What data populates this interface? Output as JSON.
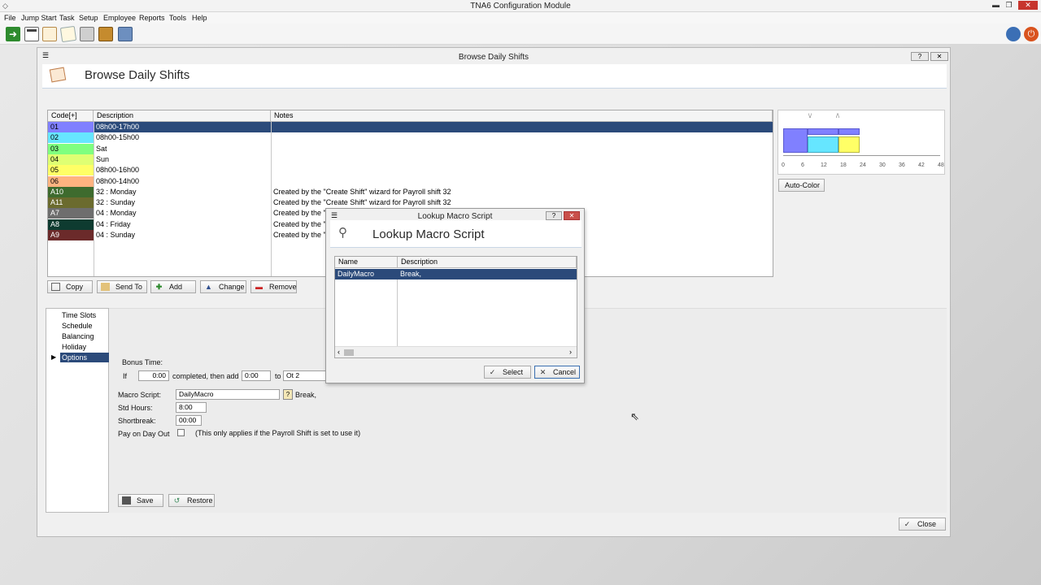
{
  "app": {
    "title": "TNA6 Configuration Module",
    "menu": [
      "File",
      "Jump Start",
      "Task",
      "Setup",
      "Employee",
      "Reports",
      "Tools",
      "Help"
    ],
    "toolbar_icons": [
      "exit-icon",
      "calendar-icon",
      "schedule-icon",
      "notepad-icon",
      "printer-icon",
      "tools-icon",
      "wizard-icon"
    ]
  },
  "window": {
    "title": "Browse Daily Shifts",
    "heading": "Browse Daily Shifts",
    "help_label": "?",
    "close_label": "✕"
  },
  "grid": {
    "columns": [
      "Code[+]",
      "Description",
      "Notes"
    ],
    "rows": [
      {
        "code": "01",
        "color": "#8080ff",
        "description": "08h00-17h00",
        "notes": "",
        "selected": true
      },
      {
        "code": "02",
        "color": "#66e6ff",
        "description": "08h00-15h00",
        "notes": ""
      },
      {
        "code": "03",
        "color": "#7fff7f",
        "description": "Sat",
        "notes": ""
      },
      {
        "code": "04",
        "color": "#dfff73",
        "description": "Sun",
        "notes": ""
      },
      {
        "code": "05",
        "color": "#ffff66",
        "description": "08h00-16h00",
        "notes": ""
      },
      {
        "code": "06",
        "color": "#ffb380",
        "description": "08h00-14h00",
        "notes": ""
      },
      {
        "code": "A10",
        "color": "#3e6b2e",
        "description": "32 : Monday",
        "notes": "Created by the \"Create Shift\" wizard for Payroll shift 32",
        "dark": true
      },
      {
        "code": "A11",
        "color": "#6b6b2e",
        "description": "32 : Sunday",
        "notes": "Created by the \"Create Shift\" wizard for Payroll shift 32",
        "dark": true
      },
      {
        "code": "A7",
        "color": "#6e6e6e",
        "description": "04 : Monday",
        "notes": "Created by the \"C",
        "dark": true
      },
      {
        "code": "A8",
        "color": "#0e3b30",
        "description": "04 : Friday",
        "notes": "Created by the \"C",
        "dark": true
      },
      {
        "code": "A9",
        "color": "#6b2a2a",
        "description": "04 : Sunday",
        "notes": "Created by the \"C",
        "dark": true
      }
    ]
  },
  "grid_buttons": {
    "copy": "Copy",
    "send_to": "Send To",
    "add": "Add",
    "change": "Change",
    "remove": "Remove"
  },
  "preview": {
    "ticks": [
      "0",
      "6",
      "12",
      "18",
      "24",
      "30",
      "36",
      "42",
      "48"
    ],
    "auto_color_label": "Auto-Color"
  },
  "nav": {
    "items": [
      "Time Slots",
      "Schedule",
      "Balancing",
      "Holiday",
      "Options"
    ],
    "selected": "Options"
  },
  "options": {
    "bonus_time_label": "Bonus Time:",
    "if_label": "If",
    "if_value": "0:00",
    "completed_label": "completed, then add",
    "add_value": "0:00",
    "to_label": "to",
    "to_value": "Ot 2",
    "macro_label": "Macro Script:",
    "macro_value": "DailyMacro",
    "macro_desc": "Break,",
    "std_hours_label": "Std Hours:",
    "std_hours_value": "8:00",
    "shortbreak_label": "Shortbreak:",
    "shortbreak_value": "00:00",
    "pay_day_out_label": "Pay on Day Out",
    "pay_day_out_note": "(This only applies if the Payroll Shift is set to use it)",
    "save_label": "Save",
    "restore_label": "Restore"
  },
  "footer": {
    "close_label": "Close"
  },
  "lookup": {
    "title": "Lookup Macro Script",
    "heading": "Lookup Macro Script",
    "columns": [
      "Name",
      "Description"
    ],
    "rows": [
      {
        "name": "DailyMacro",
        "description": "Break,"
      }
    ],
    "select_label": "Select",
    "cancel_label": "Cancel"
  },
  "colors": {
    "selection": "#2b4a7a",
    "accent_border": "#c9d6e6"
  }
}
